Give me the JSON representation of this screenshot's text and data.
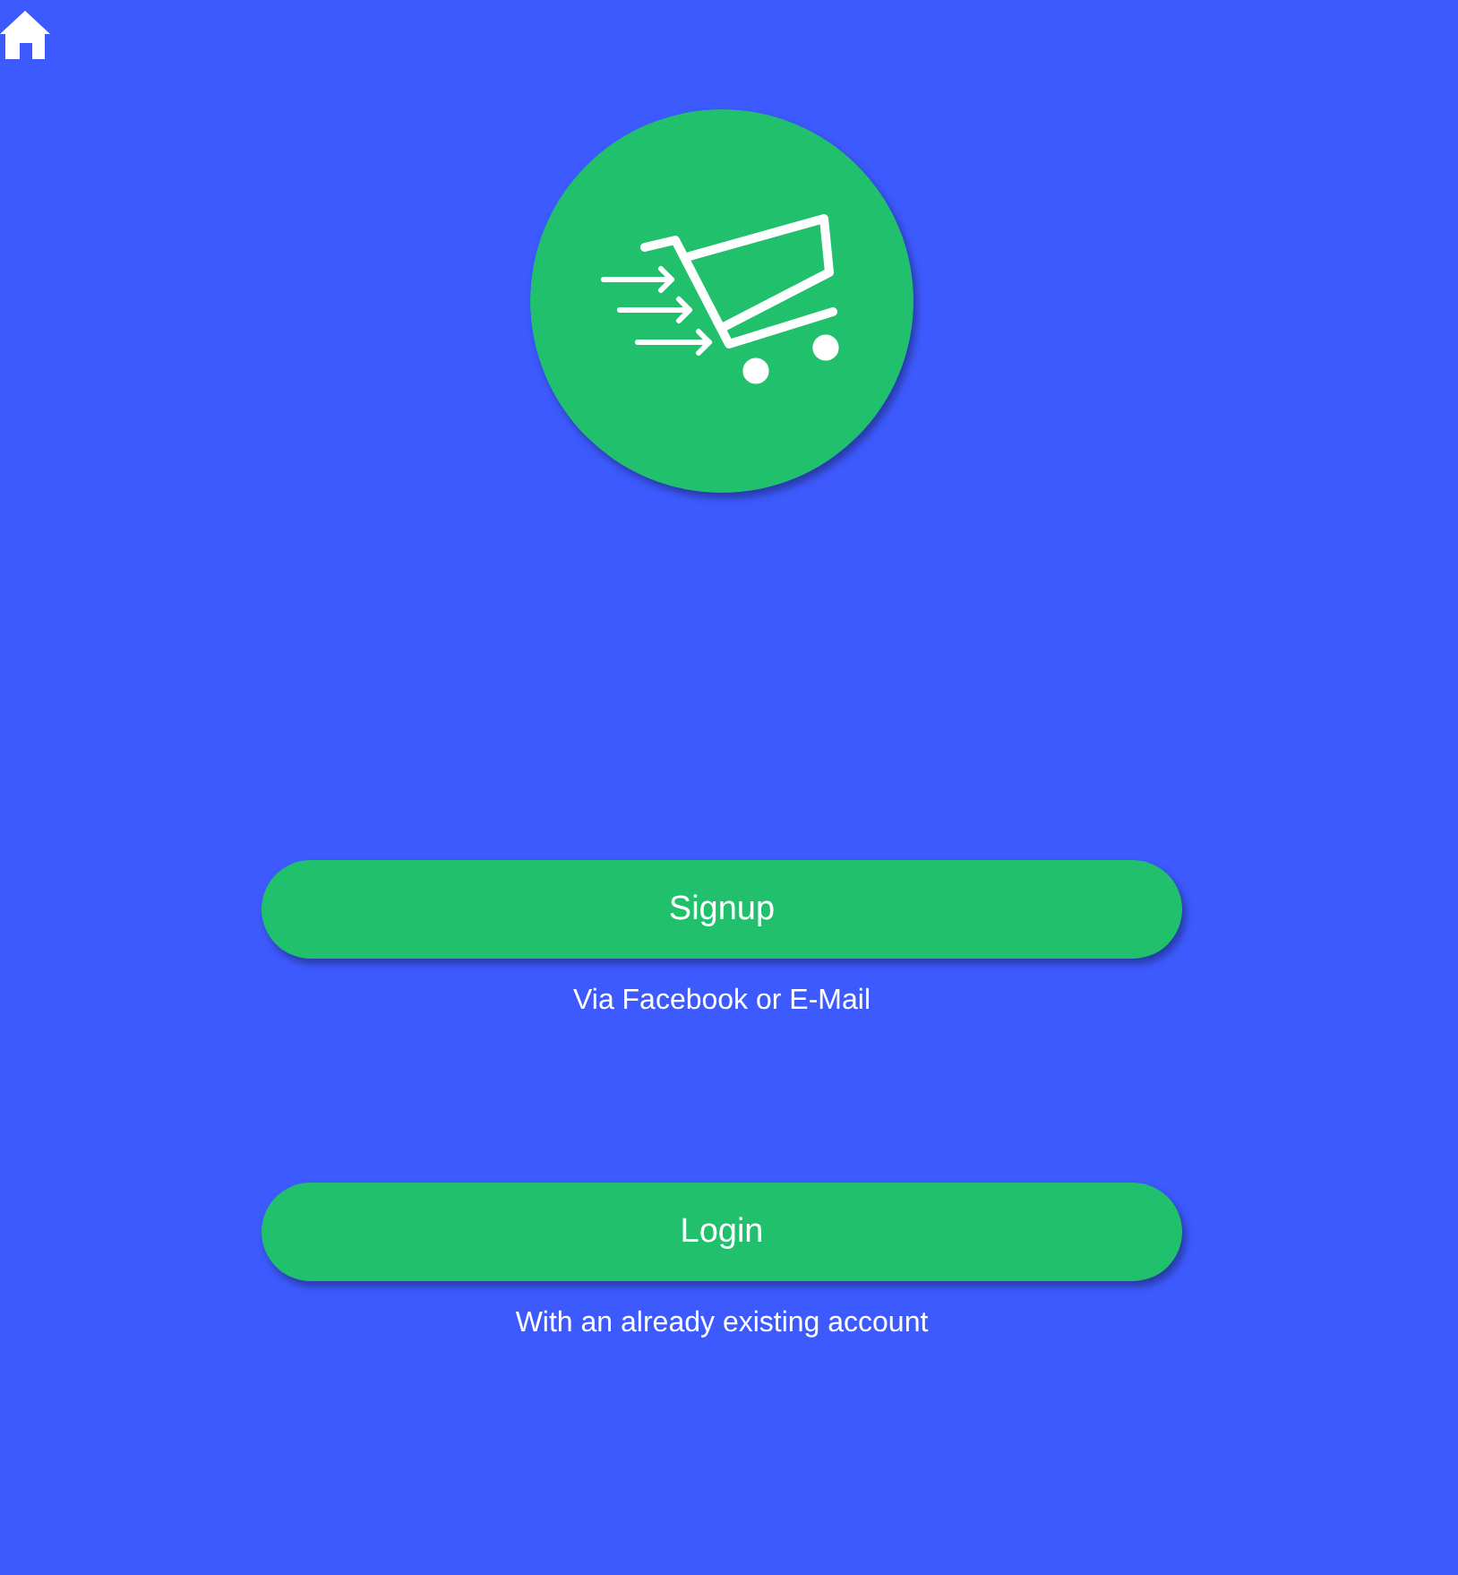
{
  "actions": [
    {
      "label": "Signup",
      "caption": "Via Facebook or E-Mail"
    },
    {
      "label": "Login",
      "caption": "With an already existing account"
    }
  ]
}
